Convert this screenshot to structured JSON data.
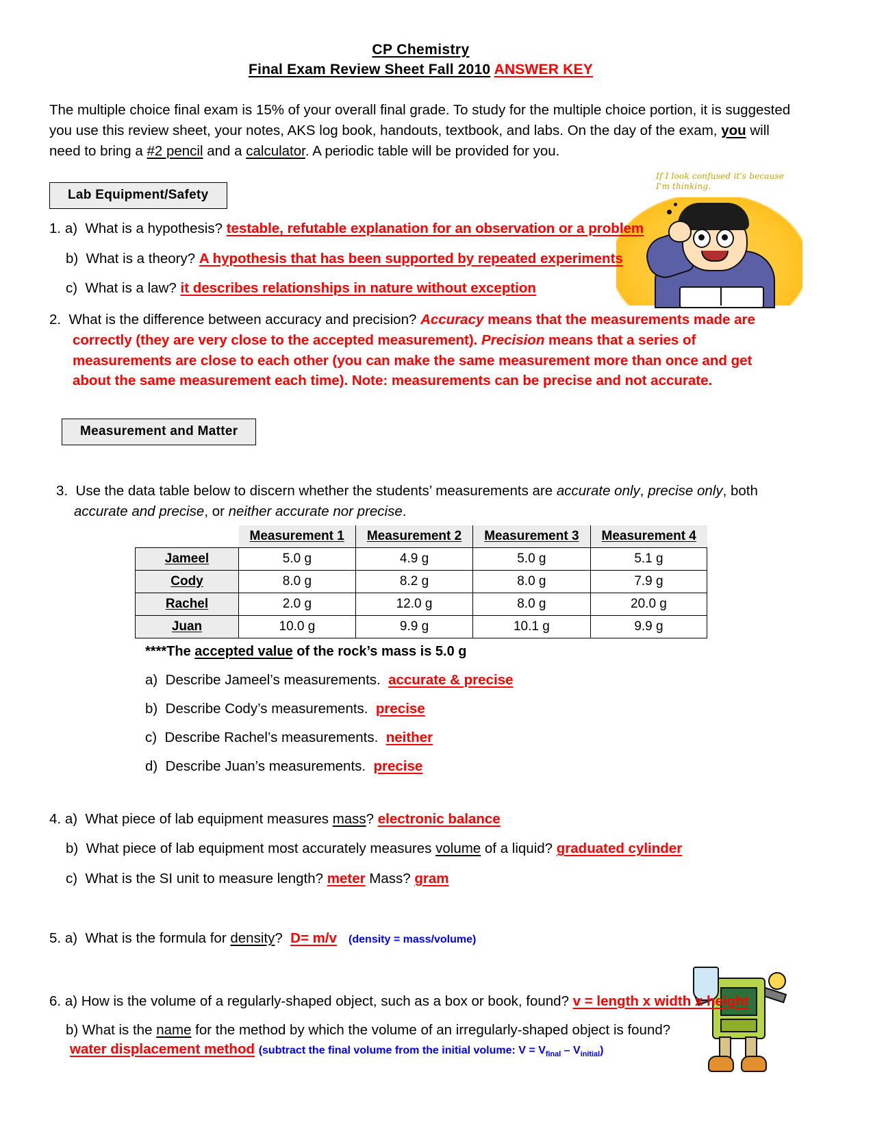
{
  "document": {
    "title_line1": "CP Chemistry",
    "title_line2_black": "Final Exam Review Sheet Fall 2010",
    "title_line2_red": "ANSWER KEY",
    "intro": {
      "part1": "The multiple choice final exam is 15% of your overall final grade.  To study for the multiple choice portion, it is suggested you use this review sheet, your notes, AKS log book, handouts, textbook, and labs.  On the day of the exam, ",
      "you": "you",
      "part2": " will need to bring a ",
      "pencil": "#2 pencil",
      "part3": " and a ",
      "calculator": "calculator",
      "part4": ".  A periodic table will be provided for you."
    }
  },
  "sections": {
    "lab_equipment": "Lab Equipment/Safety",
    "measurement_matter": "Measurement and Matter"
  },
  "q1": {
    "num": "1.",
    "a_label": "a)",
    "a_question": "What is a hypothesis?",
    "a_answer": "testable, refutable explanation for an observation or a problem",
    "b_label": "b)",
    "b_question": "What is a theory?",
    "b_answer": "A hypothesis that has been supported by repeated experiments",
    "c_label": "c)",
    "c_question": "What is a law?",
    "c_answer": "it describes relationships in nature without exception"
  },
  "q2": {
    "num": "2.",
    "question": "What is the difference between accuracy and precision?",
    "accuracy_word": "Accuracy",
    "accuracy_text": " means that the measurements made are",
    "line2_a": "correctly (they are very close to the accepted measurement).  ",
    "precision_word": "Precision",
    "line2_b": " means that a series of",
    "line3": "measurements are close to each other (you can make the same measurement more than once and get",
    "line4": "about the same measurement each time).  Note: measurements can be precise and not accurate."
  },
  "q3": {
    "num": "3.",
    "line1_a": "Use the data table below to discern whether the students’ measurements are ",
    "accurate_only": "accurate only",
    "line1_b": ", ",
    "precise_only": "precise only",
    "line1_c": ", both",
    "line2_a": "accurate and precise",
    "line2_b": ", or ",
    "line2_c": "neither accurate nor precise",
    "line2_d": ".",
    "table": {
      "columns": [
        "Measurement 1",
        "Measurement 2",
        "Measurement 3",
        "Measurement 4"
      ],
      "rows": [
        {
          "name": "Jameel",
          "values": [
            "5.0 g",
            "4.9 g",
            "5.0 g",
            "5.1 g"
          ]
        },
        {
          "name": "Cody",
          "values": [
            "8.0 g",
            "8.2 g",
            "8.0 g",
            "7.9 g"
          ]
        },
        {
          "name": "Rachel",
          "values": [
            "2.0 g",
            "12.0 g",
            "8.0 g",
            "20.0 g"
          ]
        },
        {
          "name": "Juan",
          "values": [
            "10.0 g",
            "9.9 g",
            "10.1 g",
            "9.9 g"
          ]
        }
      ]
    },
    "accepted_prefix": "****The ",
    "accepted_underline": "accepted value",
    "accepted_suffix": " of the rock’s mass is 5.0 g",
    "subs": [
      {
        "label": "a)",
        "text": "Describe Jameel’s measurements.",
        "answer": "accurate & precise"
      },
      {
        "label": "b)",
        "text": "Describe Cody’s measurements.",
        "answer": "precise"
      },
      {
        "label": "c)",
        "text": "Describe Rachel’s measurements.",
        "answer": "neither"
      },
      {
        "label": "d)",
        "text": "Describe Juan’s measurements.",
        "answer": "precise"
      }
    ]
  },
  "q4": {
    "num": "4.",
    "a_label": "a)",
    "a_q_pre": "What piece of lab equipment measures ",
    "a_q_underline": "mass",
    "a_q_post": "?",
    "a_answer": "electronic balance",
    "b_label": "b)",
    "b_q_pre": "What piece of lab equipment most accurately measures ",
    "b_q_underline": "volume",
    "b_q_post": " of a liquid?",
    "b_answer": "graduated cylinder",
    "c_label": "c)",
    "c_q": "What is the SI unit to measure length?",
    "c_answer1": "meter",
    "c_mid": "Mass?",
    "c_answer2": "gram"
  },
  "q5": {
    "num": "5.",
    "a_label": "a)",
    "q_pre": "What is the formula for ",
    "q_underline": "density",
    "q_post": "?",
    "answer": "D= m/v",
    "note": "(density = mass/volume)"
  },
  "q6": {
    "num": "6.",
    "a_label": "a)",
    "a_question": "How is the volume of a regularly-shaped object, such as a box or book, found?",
    "a_answer": "v = length x width x height",
    "b_label": "b)",
    "b_q_pre": "What is the ",
    "b_q_underline": "name",
    "b_q_post": " for the method by which the volume of an irregularly-shaped object is found?",
    "b_answer": "water displacement method",
    "b_note_pre": "(subtract the final volume from the initial volume:  V = V",
    "b_note_sub1": "final",
    "b_note_mid": " – V",
    "b_note_sub2": "initial",
    "b_note_post": ")"
  },
  "clipart": {
    "student_caption": "If I look confused it's because I'm thinking.",
    "student_name": "thinking-student-clipart",
    "bot_name": "lab-robot-clipart"
  },
  "colors": {
    "answer_red": "#ff0000",
    "note_blue": "#0000ff",
    "section_bg": "#ececec"
  }
}
